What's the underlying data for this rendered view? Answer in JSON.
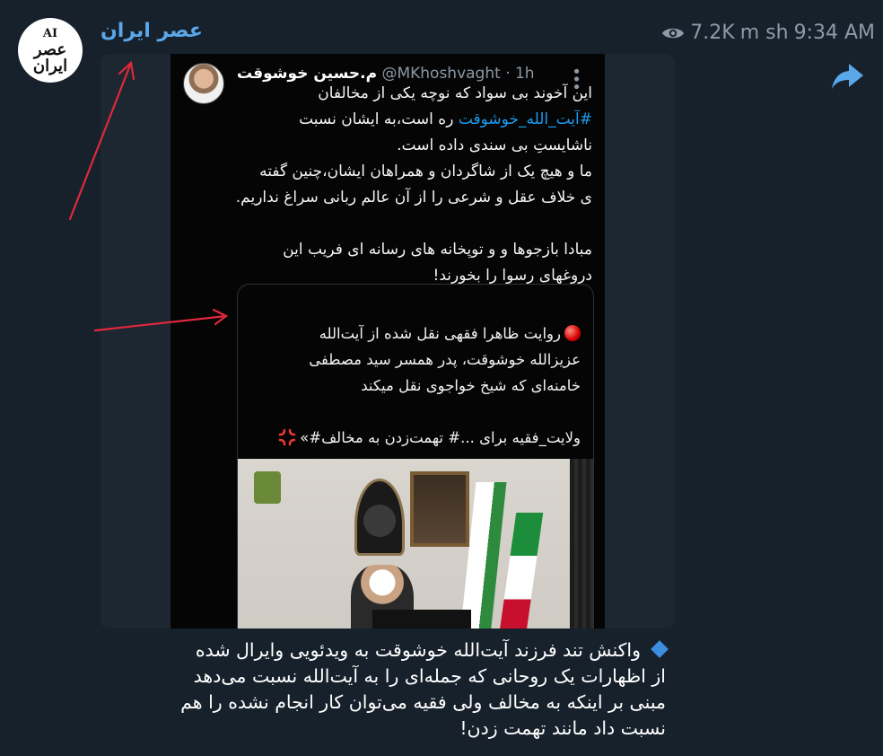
{
  "channel": {
    "name": "عصر ایران",
    "logo_text": "عصر ایران",
    "logo_sub": "AI"
  },
  "post": {
    "views": "7.2K",
    "author_sign": "m sh",
    "time": "9:34 AM",
    "caption": [
      "واکنش تند فرزند آیت‌الله خوشوقت به ویدئویی وایرال شده",
      "از اظهارات یک روحانی که جمله‌ای را به آیت‌الله نسبت می‌دهد",
      "مبنی بر اینکه به مخالف ولی فقیه می‌توان کار انجام نشده را هم",
      "نسبت داد مانند تهمت زدن!"
    ]
  },
  "tweet": {
    "display_name": "م.حسین خوشوقت",
    "handle": "@MKhoshvaght · 1h",
    "lines": [
      "این آخوند بی سواد که نوچه یکی از مخالفان",
      "#آیت_الله_خوشوقت ره است،به ایشان نسبت",
      "ناشایستِ بی سندی داده است.",
      "ما و هیچ یک از شاگردان و همراهان ایشان،چنین گفته",
      "ی خلاف عقل و شرعی را از آن عالم ربانی سراغ نداریم.",
      "",
      "مبادا بازجوها و و توپخانه های رسانه ای فریب این",
      "دروغهای رسوا را بخورند!"
    ],
    "hashtag_prefix": "#آیت_الله_خوشوقت",
    "hashtag_rest": " ره است،به ایشان نسبت"
  },
  "quote": {
    "line1": "روایت ظاهرا فقهی نقل شده از آیت‌الله",
    "line2": "عزیزالله خوشوقت، پدر همسر سید مصطفی",
    "line3": "خامنه‌ای که شیخ خواجوی نقل میکند",
    "line4": "ولایت_فقیه برای ...# تهمت‌زدن به مخالف#»"
  },
  "colors": {
    "background": "#17212b",
    "accent": "#5aa7ea",
    "hashtag": "#1d9bf0",
    "annotation_arrow": "#e0283c"
  }
}
